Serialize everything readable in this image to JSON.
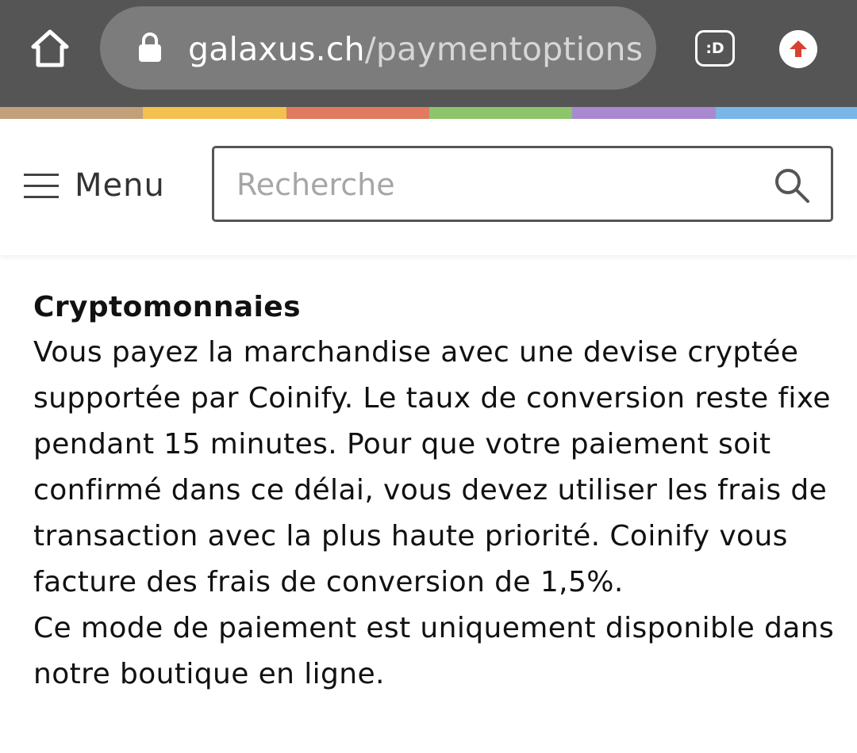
{
  "browser": {
    "url_domain": "galaxus.ch",
    "url_path": "/paymentoptions",
    "extension_label": ":D",
    "home_icon": "home-icon",
    "lock_icon": "lock-icon",
    "update_icon": "arrow-up-icon",
    "bar_color": "#555555"
  },
  "stripe_colors": [
    "#c2a07a",
    "#f2c14e",
    "#e07a60",
    "#8cc56a",
    "#a98ad0",
    "#7ab6e6"
  ],
  "header": {
    "menu_label": "Menu",
    "menu_icon": "hamburger-icon",
    "search_placeholder": "Recherche",
    "search_icon": "search-icon"
  },
  "content": {
    "heading": "Cryptomonnaies",
    "paragraph_1": "Vous payez la marchandise avec une devise cryptée supportée par Coinify. Le taux de conversion reste fixe pendant 15 minutes. Pour que votre paiement soit confirmé dans ce délai, vous devez utiliser les frais de transaction avec la plus haute priorité. Coinify vous facture des frais de conversion de 1,5%.",
    "paragraph_2": "Ce mode de paiement est uniquement disponible dans notre boutique en ligne."
  }
}
